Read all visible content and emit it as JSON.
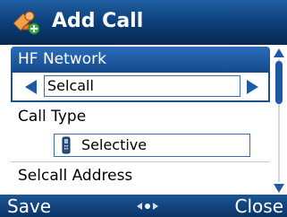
{
  "header": {
    "title": "Add Call",
    "icon": "people-add-icon"
  },
  "form": {
    "hf_network_label": "HF Network",
    "hf_network_value": "Selcall",
    "call_type_label": "Call Type",
    "call_type_value": "Selective",
    "call_type_icon": "handset-icon",
    "selcall_address_label": "Selcall Address"
  },
  "softkeys": {
    "left": "Save",
    "right": "Close",
    "center_icon": "dpad-icon"
  },
  "colors": {
    "header_bg": "#0d3f7a",
    "selected_row_bg": "#1f5fa3",
    "accent_blue": "#1e5aa3",
    "softbar_bg": "#12457f"
  }
}
